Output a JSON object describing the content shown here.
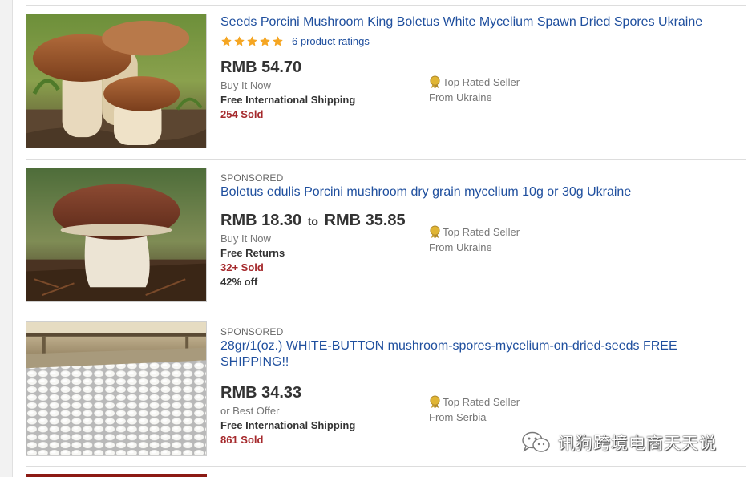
{
  "listings": [
    {
      "sponsored": "",
      "title": "Seeds Porcini Mushroom King Boletus White Mycelium Spawn Dried Spores Ukraine",
      "ratings_text": "6 product ratings",
      "stars": 5,
      "price": "RMB 54.70",
      "price_to_word": "",
      "price_high": "",
      "format": "Buy It Now",
      "shipping": "Free International Shipping",
      "sold": "254 Sold",
      "discount": "",
      "seller_badge": "Top Rated Seller",
      "location": "From Ukraine",
      "image_icon": "porcini-mushrooms-photo"
    },
    {
      "sponsored": "SPONSORED",
      "title": "Boletus edulis Porcini mushroom dry grain mycelium 10g or 30g Ukraine",
      "ratings_text": "",
      "stars": 0,
      "price": "RMB 18.30",
      "price_to_word": "to",
      "price_high": "RMB 35.85",
      "format": "Buy It Now",
      "shipping": "Free Returns",
      "sold": "32+ Sold",
      "discount": "42% off",
      "seller_badge": "Top Rated Seller",
      "location": "From Ukraine",
      "image_icon": "single-porcini-photo"
    },
    {
      "sponsored": "SPONSORED",
      "title": "28gr/1(oz.) WHITE-BUTTON mushroom-spores-mycelium-on-dried-seeds FREE SHIPPING!!",
      "ratings_text": "",
      "stars": 0,
      "price": "RMB 34.33",
      "price_to_word": "",
      "price_high": "",
      "format": "or Best Offer",
      "shipping": "Free International Shipping",
      "sold": "861 Sold",
      "discount": "",
      "seller_badge": "Top Rated Seller",
      "location": "From Serbia",
      "image_icon": "white-button-mushroom-farm-photo"
    }
  ],
  "watermark": {
    "text": "讯狗跨境电商天天说",
    "icon": "wechat-icon"
  },
  "colors": {
    "link": "#1f4f9e",
    "sold": "#a5292c",
    "star": "#f5a623",
    "medal": "#e0b534"
  }
}
